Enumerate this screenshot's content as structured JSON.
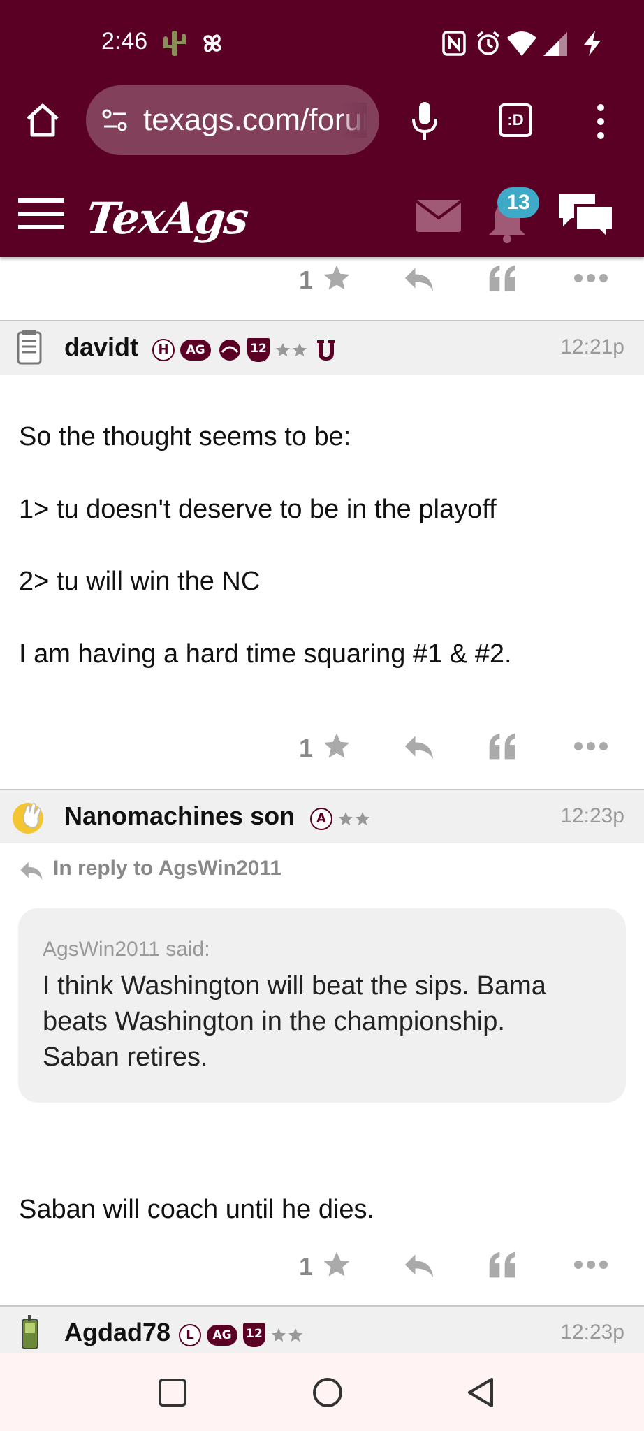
{
  "status_bar": {
    "time": "2:46"
  },
  "browser": {
    "url": "texags.com/forums",
    "tab_count_label": ":D"
  },
  "site": {
    "logo": "TexAgs",
    "notification_count": "13"
  },
  "posts": [
    {
      "actions": {
        "like_count": "1"
      }
    },
    {
      "author": "davidt",
      "time": "12:21p",
      "flair": [
        "H",
        "AG",
        "12"
      ],
      "body": [
        "So the thought seems to be:",
        "1> tu doesn't deserve to be in the playoff",
        "2> tu will win the NC",
        "I am having a hard time squaring #1 & #2."
      ],
      "actions": {
        "like_count": "1"
      }
    },
    {
      "author": "Nanomachines son",
      "time": "12:23p",
      "flair": [
        "A"
      ],
      "reply_to": "In reply to AgsWin2011",
      "quote": {
        "said": "AgsWin2011 said:",
        "lines": [
          "I think Washington will beat the sips. Bama",
          "beats Washington in the championship.",
          "Saban retires."
        ]
      },
      "body": [
        "Saban will coach until he dies."
      ],
      "actions": {
        "like_count": "1"
      }
    },
    {
      "author": "Agdad78",
      "time": "12:23p",
      "flair": [
        "L",
        "AG",
        "12"
      ]
    }
  ],
  "colors": {
    "brand_maroon": "#5a0024",
    "badge_blue": "#3fa9c8",
    "action_gray": "#aaaaaa"
  }
}
